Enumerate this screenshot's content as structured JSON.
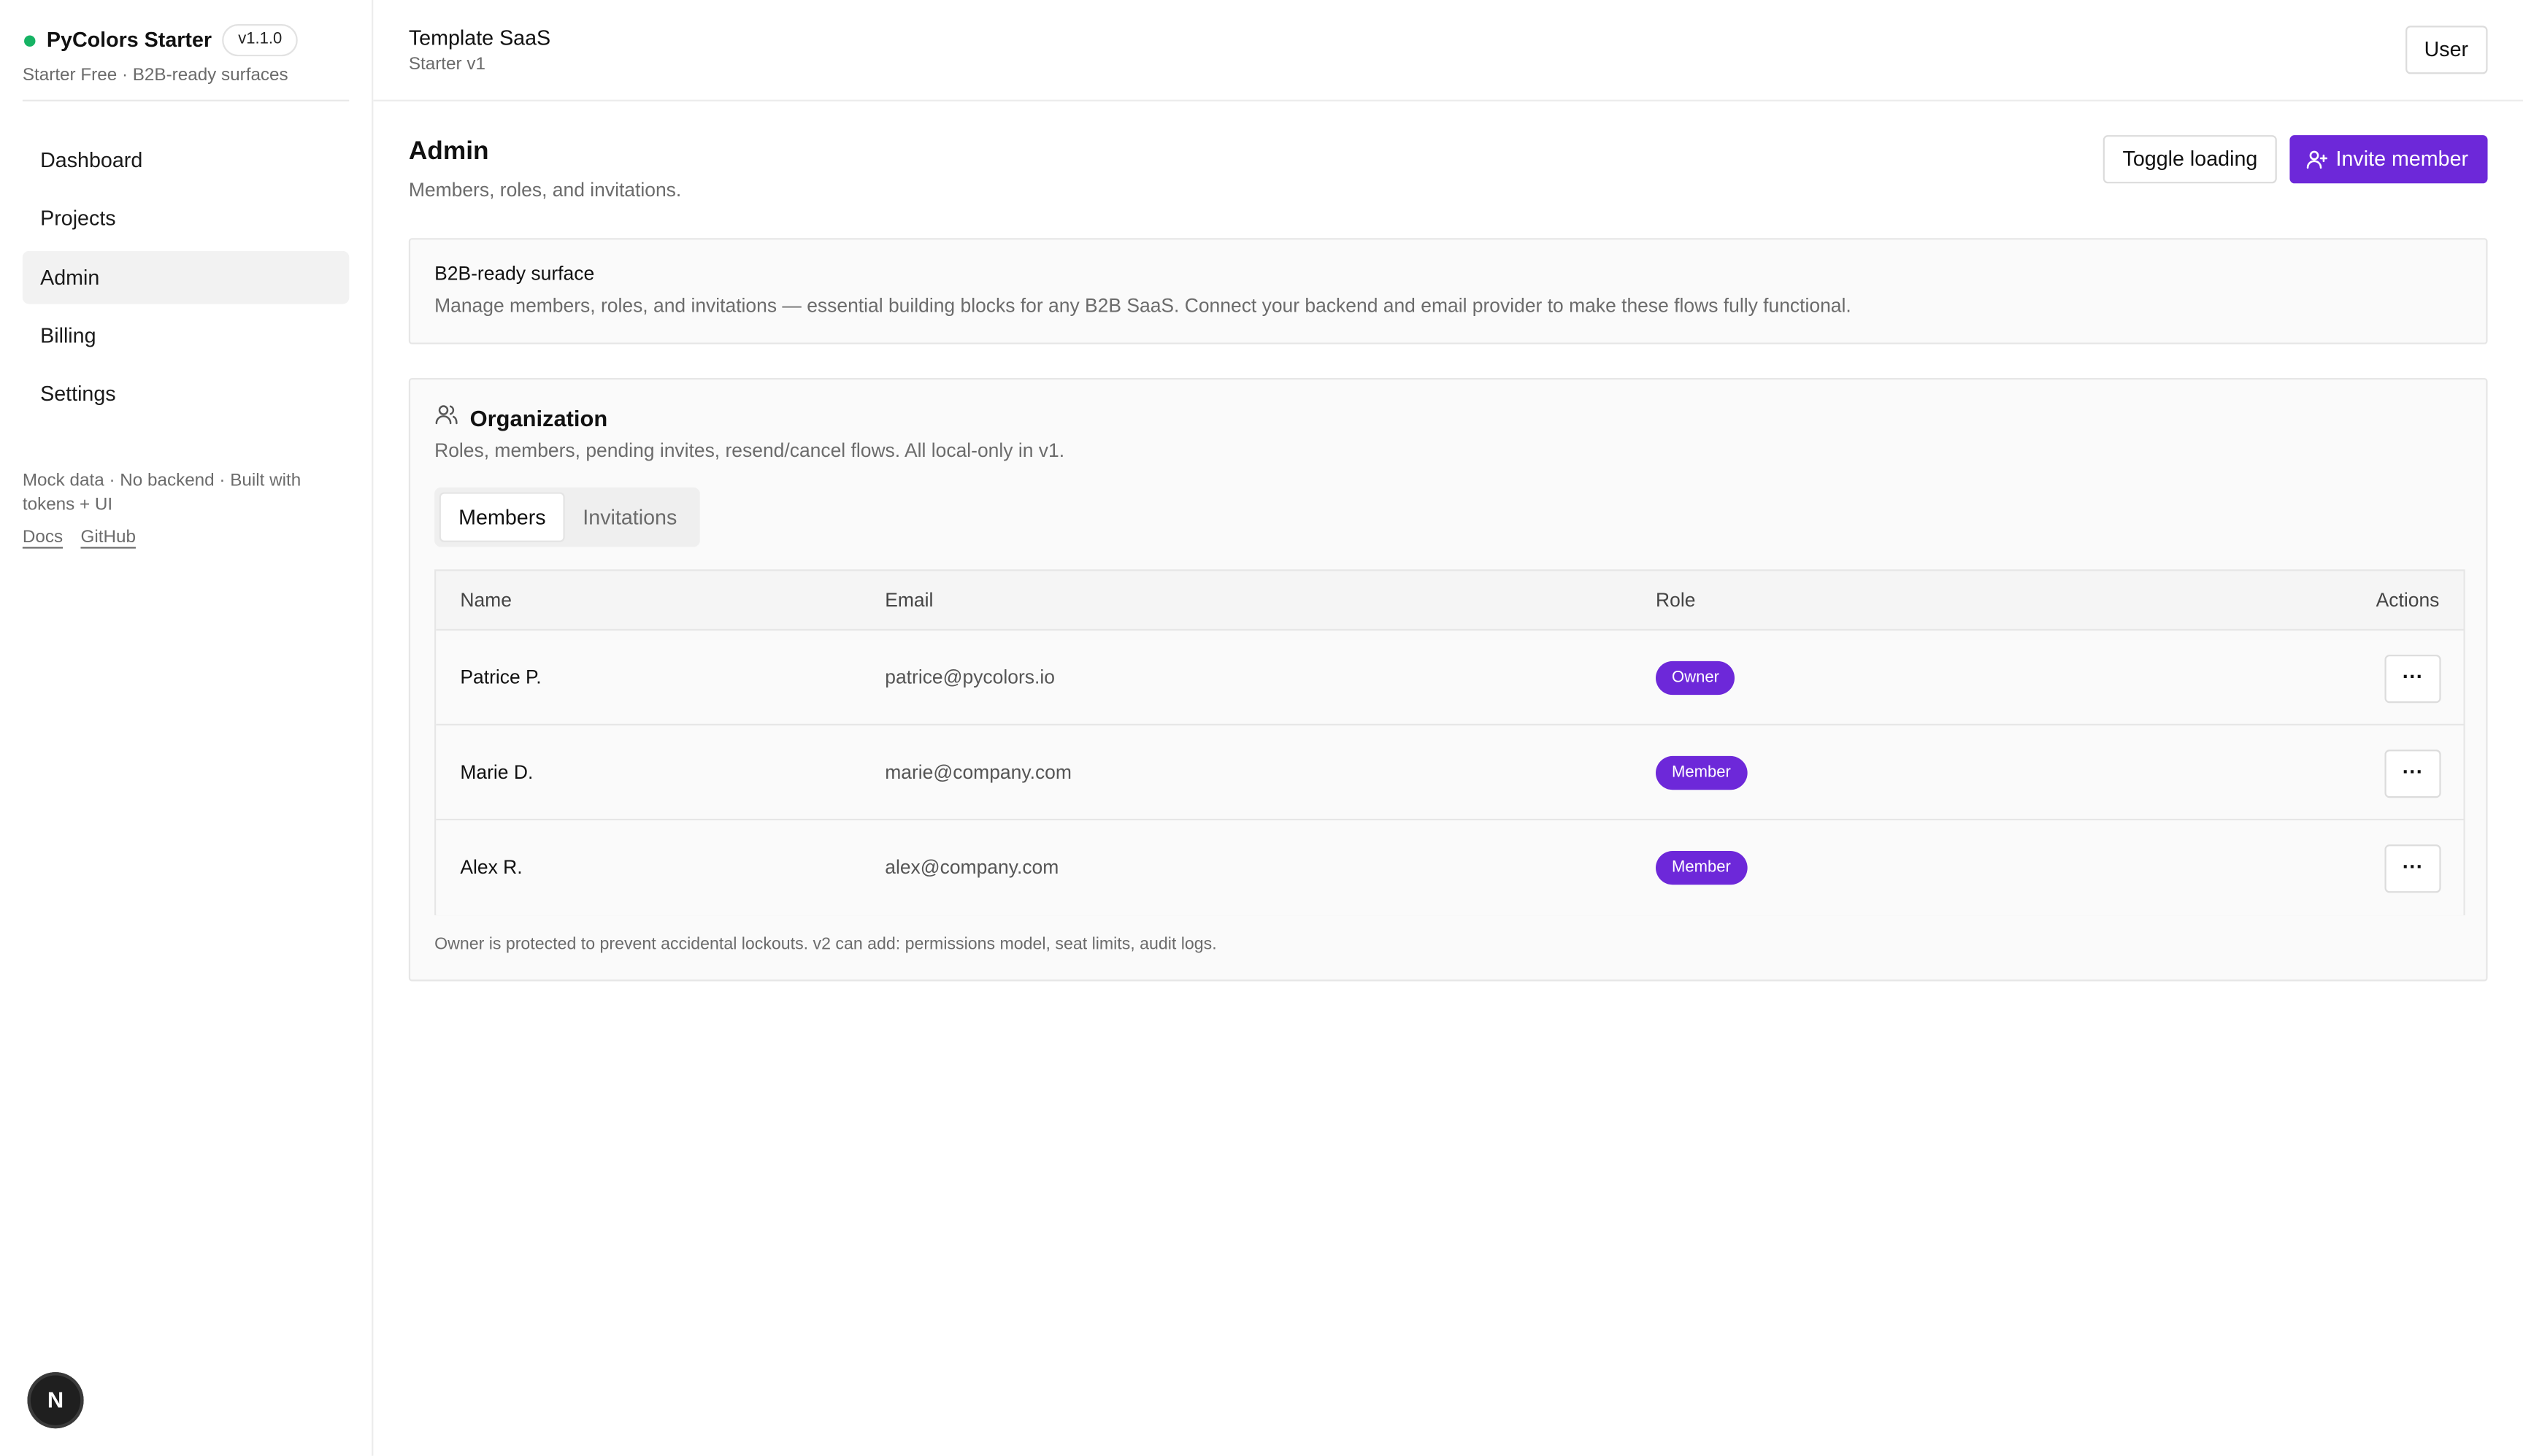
{
  "brand": {
    "name": "PyColors Starter",
    "version": "v1.1.0",
    "subtitle": "Starter Free · B2B-ready surfaces",
    "status_color": "#16b364"
  },
  "sidebar": {
    "items": [
      {
        "label": "Dashboard",
        "active": false
      },
      {
        "label": "Projects",
        "active": false
      },
      {
        "label": "Admin",
        "active": true
      },
      {
        "label": "Billing",
        "active": false
      },
      {
        "label": "Settings",
        "active": false
      }
    ],
    "note": "Mock data · No backend · Built with tokens + UI",
    "links": {
      "docs": "Docs",
      "github": "GitHub"
    },
    "dev_badge": "N"
  },
  "header": {
    "title": "Template SaaS",
    "subtitle": "Starter v1",
    "user_button": "User"
  },
  "page": {
    "title": "Admin",
    "subtitle": "Members, roles, and invitations.",
    "toggle_loading": "Toggle loading",
    "invite_member": "Invite member",
    "accent": "#6d28d9"
  },
  "notice": {
    "title": "B2B-ready surface",
    "body": "Manage members, roles, and invitations — essential building blocks for any B2B SaaS. Connect your backend and email provider to make these flows fully functional."
  },
  "organization": {
    "title": "Organization",
    "subtitle": "Roles, members, pending invites, resend/cancel flows. All local-only in v1.",
    "tabs": [
      {
        "label": "Members",
        "active": true
      },
      {
        "label": "Invitations",
        "active": false
      }
    ],
    "columns": {
      "name": "Name",
      "email": "Email",
      "role": "Role",
      "actions": "Actions"
    },
    "rows": [
      {
        "name": "Patrice P.",
        "email": "patrice@pycolors.io",
        "role": "Owner",
        "action": "···"
      },
      {
        "name": "Marie D.",
        "email": "marie@company.com",
        "role": "Member",
        "action": "···"
      },
      {
        "name": "Alex R.",
        "email": "alex@company.com",
        "role": "Member",
        "action": "···"
      }
    ],
    "footnote": "Owner is protected to prevent accidental lockouts. v2 can add: permissions model, seat limits, audit logs."
  }
}
